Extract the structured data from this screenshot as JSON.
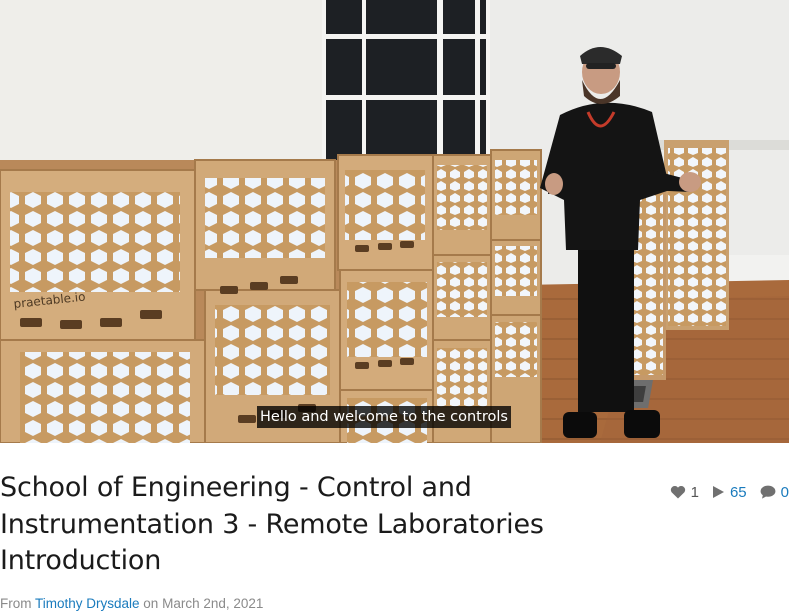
{
  "video": {
    "caption": "Hello and welcome to the controls",
    "box_logo_text": "praetable.io"
  },
  "title_lines": [
    "School of Engineering - Control and",
    "Instrumentation 3 - Remote Laboratories",
    "Introduction"
  ],
  "stats": {
    "likes": "1",
    "plays": "65",
    "comments": "0"
  },
  "byline": {
    "prefix": "From ",
    "author": "Timothy Drysdale",
    "middle": " on ",
    "date": "March 2nd, 2021"
  },
  "colors": {
    "link": "#1a7bbd",
    "title": "#1b1b1b",
    "muted": "#8a8a8a"
  },
  "icons": [
    "heart-icon",
    "play-icon",
    "comment-icon"
  ]
}
